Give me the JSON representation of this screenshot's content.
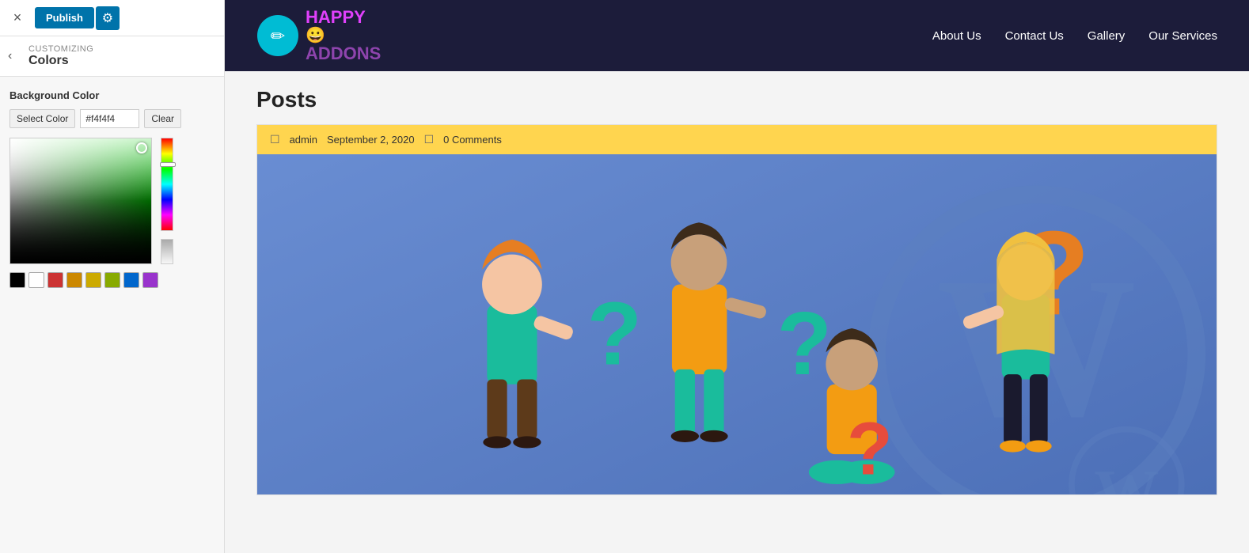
{
  "topbar": {
    "close_label": "×",
    "publish_label": "Publish",
    "gear_label": "⚙"
  },
  "customizing": {
    "back_label": "‹",
    "section": "Customizing",
    "title": "Colors"
  },
  "colorpicker": {
    "section_label": "Background Color",
    "select_color_btn": "Select Color",
    "hex_value": "#f4f4f4",
    "clear_btn": "Clear",
    "swatches": [
      "#000000",
      "#ffffff",
      "#cc3333",
      "#cc8800",
      "#ccaa00",
      "#88aa00",
      "#0066cc",
      "#9933cc"
    ]
  },
  "site": {
    "logo_icon": "✏",
    "logo_top": "HAPPY 😀",
    "logo_bottom": "ADDONS",
    "nav": [
      {
        "label": "About Us"
      },
      {
        "label": "Contact Us"
      },
      {
        "label": "Gallery"
      },
      {
        "label": "Our Services"
      }
    ]
  },
  "page": {
    "posts_title": "Posts",
    "meta": {
      "author_icon": "☐",
      "author": "admin",
      "date": "September 2, 2020",
      "comment_icon": "☐",
      "comments": "0 Comments"
    }
  }
}
